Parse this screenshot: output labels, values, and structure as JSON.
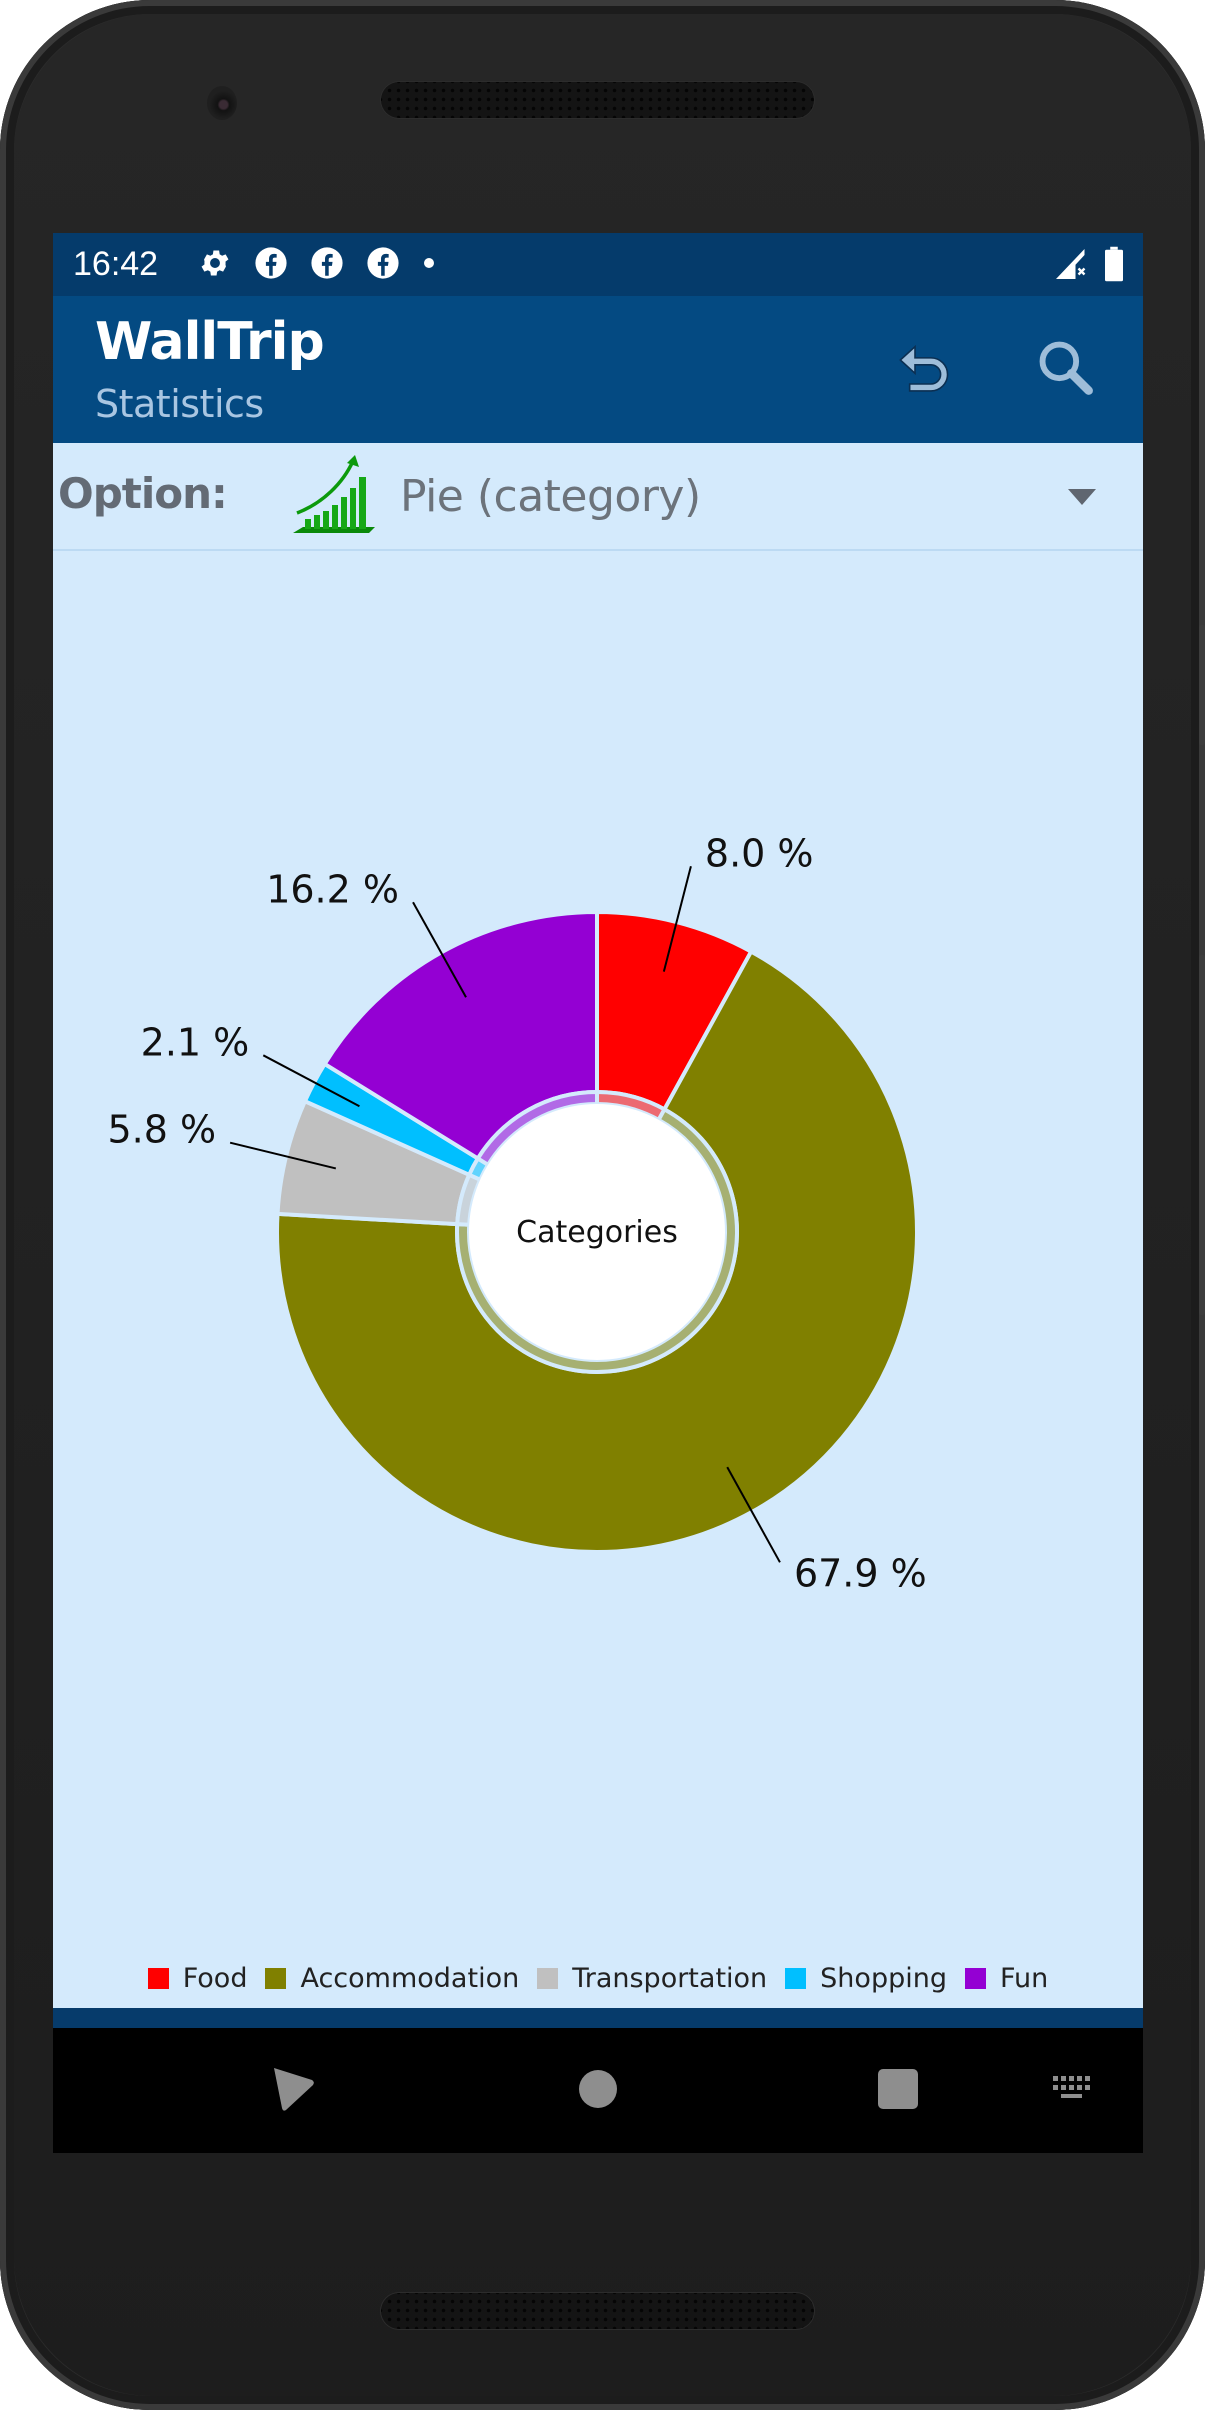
{
  "status_bar": {
    "time": "16:42",
    "left_icons": [
      "gear-icon",
      "facebook-icon",
      "facebook-icon",
      "facebook-icon",
      "dot-icon"
    ],
    "right_icons": [
      "signal-no-data-icon",
      "battery-icon"
    ]
  },
  "app_bar": {
    "title": "WallTrip",
    "subtitle": "Statistics",
    "actions": [
      {
        "name": "undo-button",
        "icon": "undo-icon"
      },
      {
        "name": "search-button",
        "icon": "search-icon"
      }
    ]
  },
  "option": {
    "label": "Option:",
    "icon": "growth-chart-icon",
    "selected": "Pie (category)"
  },
  "colors": {
    "status_bar": "#053b6b",
    "app_bar": "#044a82",
    "background": "#d4eafc",
    "food": "#ff0000",
    "accommodation": "#808000",
    "transportation": "#c0c0c0",
    "shopping": "#00bfff",
    "fun": "#9400d3"
  },
  "chart_data": {
    "type": "pie",
    "style": "donut",
    "center_text": "Categories",
    "start_angle": "12 o'clock",
    "direction": "clockwise",
    "categories": [
      "Food",
      "Accommodation",
      "Transportation",
      "Shopping",
      "Fun"
    ],
    "values": [
      8.0,
      67.9,
      5.8,
      2.1,
      16.2
    ],
    "labels": [
      "8.0 %",
      "67.9 %",
      "5.8 %",
      "2.1 %",
      "16.2 %"
    ],
    "colors": [
      "#ff0000",
      "#808000",
      "#c0c0c0",
      "#00bfff",
      "#9400d3"
    ],
    "legend": {
      "placement": "bottom",
      "entries": [
        "Food",
        "Accommodation",
        "Transportation",
        "Shopping",
        "Fun"
      ]
    }
  },
  "nav_bar": {
    "buttons": [
      "back-icon",
      "home-icon",
      "recents-icon",
      "keyboard-icon"
    ]
  }
}
